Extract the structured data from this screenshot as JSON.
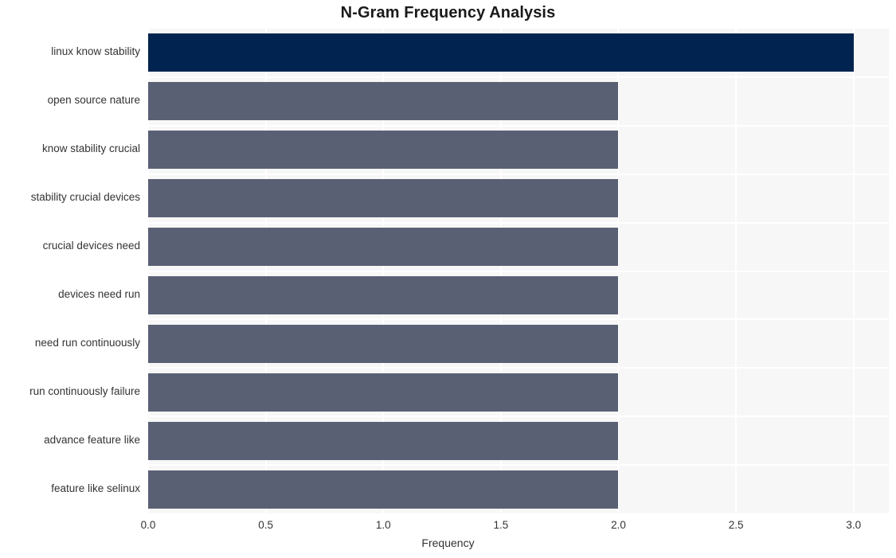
{
  "chart_data": {
    "type": "bar",
    "orientation": "horizontal",
    "title": "N-Gram Frequency Analysis",
    "xlabel": "Frequency",
    "ylabel": "",
    "xlim": [
      0.0,
      3.15
    ],
    "ylim": [
      0,
      10
    ],
    "grid": true,
    "legend": null,
    "xticks": [
      "0.0",
      "0.5",
      "1.0",
      "1.5",
      "2.0",
      "2.5",
      "3.0"
    ],
    "xtick_values": [
      0.0,
      0.5,
      1.0,
      1.5,
      2.0,
      2.5,
      3.0
    ],
    "categories": [
      "linux know stability",
      "open source nature",
      "know stability crucial",
      "stability crucial devices",
      "crucial devices need",
      "devices need run",
      "need run continuously",
      "run continuously failure",
      "advance feature like",
      "feature like selinux"
    ],
    "values": [
      3,
      2,
      2,
      2,
      2,
      2,
      2,
      2,
      2,
      2
    ],
    "bar_colors": [
      "#00244f",
      "#5a6074",
      "#5a6074",
      "#5a6074",
      "#5a6074",
      "#5a6074",
      "#5a6074",
      "#5a6074",
      "#5a6074",
      "#5a6074"
    ],
    "plot_background": "#f7f7f7",
    "grid_color": "#ffffff",
    "figure_background": "#ffffff",
    "text_color": "#333333",
    "title_color": "#1a1a1a"
  }
}
